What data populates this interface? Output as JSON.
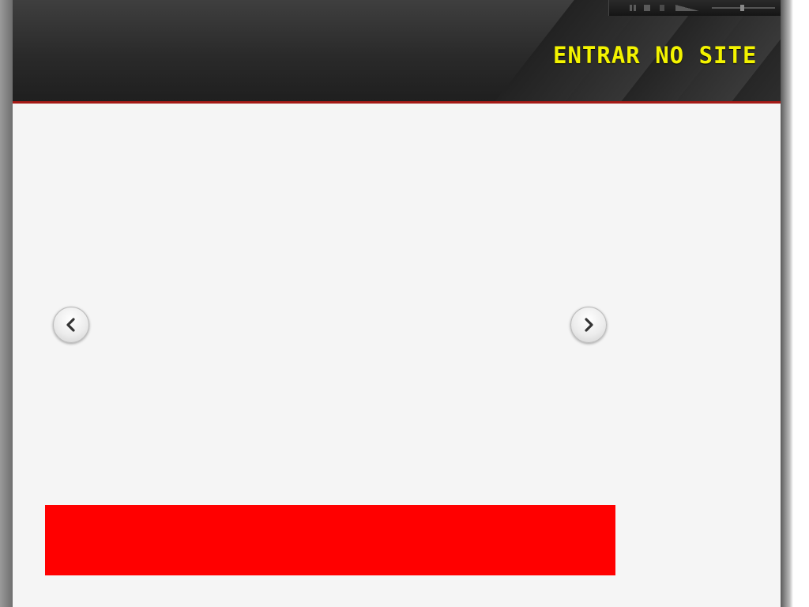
{
  "header": {
    "enter_link_label": "ENTRAR NO SITE",
    "accent_color": "#f3f300",
    "border_color": "#a51a16"
  },
  "media_player": {
    "controls": [
      "pause-icon",
      "stop-icon",
      "mute-icon",
      "volume-icon"
    ]
  },
  "slider": {
    "prev_icon": "chevron-left-icon",
    "next_icon": "chevron-right-icon"
  },
  "banner": {
    "color": "#ff0000"
  }
}
